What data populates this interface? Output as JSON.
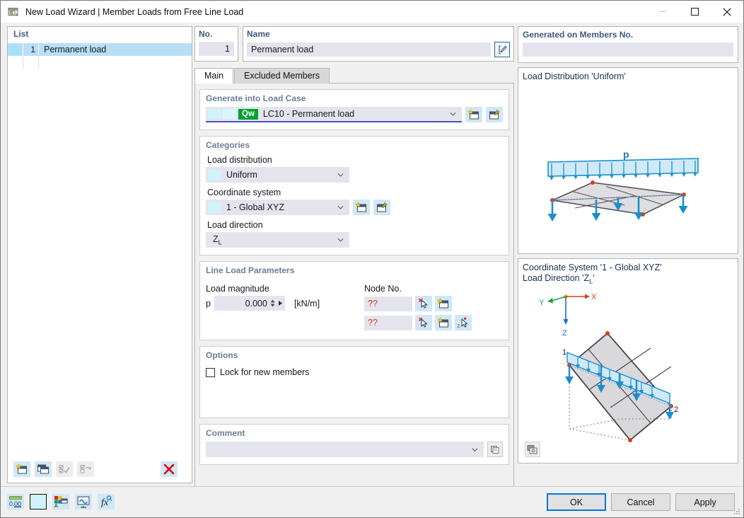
{
  "window": {
    "title": "New Load Wizard | Member Loads from Free Line Load",
    "icon": "wizard-window-icon",
    "minimize": "—",
    "maximize": "☐",
    "close": "✕"
  },
  "list_panel": {
    "header": "List",
    "rows": [
      {
        "no": "1",
        "name": "Permanent load"
      }
    ],
    "toolbar": [
      {
        "name": "new-item-button",
        "icon": "new-window-star-icon"
      },
      {
        "name": "copy-item-button",
        "icon": "copy-windows-icon"
      },
      {
        "name": "select-all-button",
        "icon": "check-all-icon",
        "disabled": true
      },
      {
        "name": "invert-selection-button",
        "icon": "invert-selection-icon",
        "disabled": true
      },
      {
        "name": "delete-item-button",
        "icon": "red-x-icon"
      }
    ]
  },
  "header_fields": {
    "no_label": "No.",
    "no_value": "1",
    "name_label": "Name",
    "name_value": "Permanent load",
    "edit_icon": "pencil-edit-icon",
    "generated_label": "Generated on Members No.",
    "generated_value": ""
  },
  "tabs": [
    {
      "label": "Main",
      "active": true
    },
    {
      "label": "Excluded Members",
      "active": false
    }
  ],
  "generate_group": {
    "title": "Generate into Load Case",
    "badge": "Qw",
    "value": "LC10 - Permanent load",
    "buttons": [
      {
        "name": "new-load-case-button",
        "icon": "new-window-star-icon"
      },
      {
        "name": "edit-load-case-button",
        "icon": "edit-window-icon"
      }
    ]
  },
  "categories_group": {
    "title": "Categories",
    "load_distribution_label": "Load distribution",
    "load_distribution_value": "Uniform",
    "coordinate_system_label": "Coordinate system",
    "coordinate_system_value": "1 - Global XYZ",
    "coordinate_buttons": [
      {
        "name": "new-coordinate-system-button",
        "icon": "new-window-star-icon"
      },
      {
        "name": "edit-coordinate-system-button",
        "icon": "edit-window-icon"
      }
    ],
    "load_direction_label": "Load direction",
    "load_direction_value": "Z",
    "load_direction_sub": "L"
  },
  "line_load_group": {
    "title": "Line Load Parameters",
    "magnitude_label": "Load magnitude",
    "magnitude_symbol": "p",
    "magnitude_value": "0.000",
    "magnitude_unit": "[kN/m]",
    "node_label": "Node No.",
    "node_rows": [
      {
        "value": "??",
        "buttons": [
          {
            "name": "pick-node-button",
            "icon": "pick-cursor-icon"
          },
          {
            "name": "new-node-button",
            "icon": "new-window-star-icon"
          }
        ]
      },
      {
        "value": "??",
        "buttons": [
          {
            "name": "pick-node-button",
            "icon": "pick-cursor-icon"
          },
          {
            "name": "new-node-button",
            "icon": "new-window-star-icon"
          },
          {
            "name": "pick-two-nodes-button",
            "icon": "pick-two-points-icon"
          }
        ]
      }
    ]
  },
  "options_group": {
    "title": "Options",
    "lock_label": "Lock for new members",
    "lock_checked": false
  },
  "comment_group": {
    "title": "Comment",
    "value": "",
    "button": {
      "name": "comment-templates-button",
      "icon": "stacked-pages-icon"
    }
  },
  "preview": {
    "distribution_title": "Load Distribution 'Uniform'",
    "distribution_symbol": "p",
    "coordinate_title_line1": "Coordinate System '1 - Global XYZ'",
    "coordinate_title_line2_prefix": "Load Direction 'Z",
    "coordinate_title_line2_sub": "L",
    "coordinate_title_line2_suffix": "'",
    "axis_x": "X",
    "axis_y": "Y",
    "axis_z": "Z",
    "node_label_1": "1",
    "node_label_2": "2",
    "snapshot_button": {
      "name": "snapshot-button",
      "icon": "camera-snapshot-icon"
    }
  },
  "bottom_toolbar": [
    {
      "name": "decimal-places-button",
      "icon": "ruler-decimals-icon",
      "label": "0.00"
    },
    {
      "name": "color-swatch-button",
      "icon": "color-swatch-icon"
    },
    {
      "name": "display-properties-button",
      "icon": "display-properties-icon"
    },
    {
      "name": "render-settings-button",
      "icon": "render-monitor-icon"
    },
    {
      "name": "formula-button",
      "icon": "function-fx-icon"
    }
  ],
  "dialog_buttons": {
    "ok": "OK",
    "cancel": "Cancel",
    "apply": "Apply"
  },
  "colors": {
    "accent_blue": "#0078d7",
    "group_title": "#6d7d96",
    "field_label": "#41597c",
    "badge_green": "#00a12c",
    "error_red": "#e03030",
    "input_bg": "#e4e4ee",
    "selection_blue": "#b8dff5"
  }
}
